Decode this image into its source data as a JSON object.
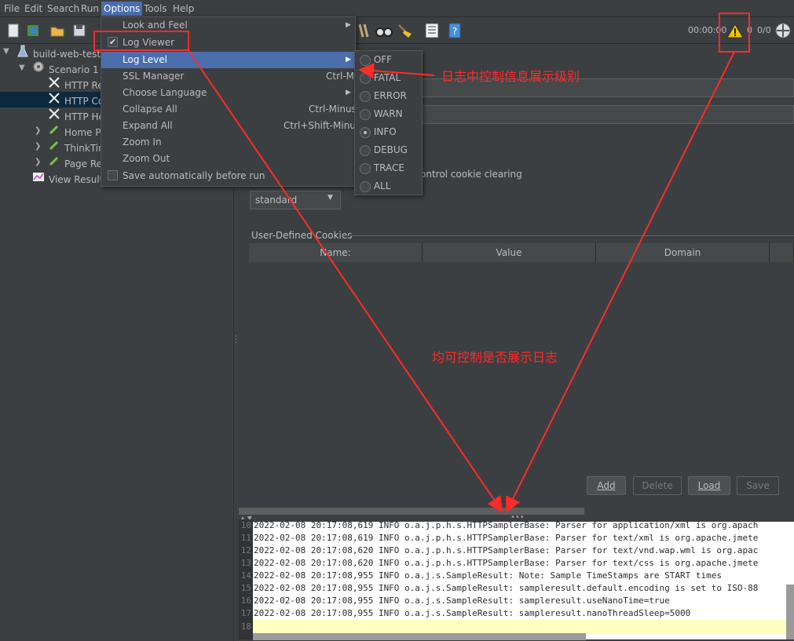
{
  "menubar": {
    "items": [
      "File",
      "Edit",
      "Search",
      "Run",
      "Options",
      "Tools",
      "Help"
    ]
  },
  "toolbar": {
    "timer": "00:00:00",
    "warning_count": "0",
    "thread_count": "0/0"
  },
  "tree": {
    "root": "build-web-test-p",
    "scenario": "Scenario 1",
    "items": [
      "HTTP Re",
      "HTTP Co",
      "HTTP He",
      "Home Pa",
      "ThinkTim",
      "Page Ret",
      "View Results"
    ]
  },
  "options_menu": {
    "items": [
      {
        "label": "Look and Feel",
        "shortcut": ""
      },
      {
        "label": "Log Viewer",
        "shortcut": ""
      },
      {
        "label": "Log Level",
        "shortcut": ""
      },
      {
        "label": "SSL Manager",
        "shortcut": "Ctrl-M"
      },
      {
        "label": "Choose Language",
        "shortcut": ""
      },
      {
        "label": "Collapse All",
        "shortcut": "Ctrl-Minus"
      },
      {
        "label": "Expand All",
        "shortcut": "Ctrl+Shift-Minus"
      },
      {
        "label": "Zoom In",
        "shortcut": ""
      },
      {
        "label": "Zoom Out",
        "shortcut": ""
      },
      {
        "label": "Save automatically before run",
        "shortcut": ""
      }
    ],
    "log_viewer_checked": true
  },
  "log_level_menu": {
    "options": [
      "OFF",
      "FATAL",
      "ERROR",
      "WARN",
      "INFO",
      "DEBUG",
      "TRACE",
      "ALL"
    ],
    "selected": "INFO"
  },
  "cookie_panel": {
    "clear_label": "ontrol cookie clearing",
    "policy": "standard",
    "section_title": "User-Defined Cookies",
    "columns": [
      "Name:",
      "Value",
      "Domain"
    ],
    "buttons": {
      "add": "Add",
      "delete": "Delete",
      "load": "Load",
      "save": "Save"
    }
  },
  "log": {
    "lines": [
      {
        "n": "10",
        "text": "2022-02-08 20:17:08,619 INFO o.a.j.p.h.s.HTTPSamplerBase: Parser for application/xml is org.apach"
      },
      {
        "n": "11",
        "text": "2022-02-08 20:17:08,619 INFO o.a.j.p.h.s.HTTPSamplerBase: Parser for text/xml is org.apache.jmete"
      },
      {
        "n": "12",
        "text": "2022-02-08 20:17:08,620 INFO o.a.j.p.h.s.HTTPSamplerBase: Parser for text/vnd.wap.wml is org.apac"
      },
      {
        "n": "13",
        "text": "2022-02-08 20:17:08,620 INFO o.a.j.p.h.s.HTTPSamplerBase: Parser for text/css is org.apache.jmete"
      },
      {
        "n": "14",
        "text": "2022-02-08 20:17:08,955 INFO o.a.j.s.SampleResult: Note: Sample TimeStamps are START times"
      },
      {
        "n": "15",
        "text": "2022-02-08 20:17:08,955 INFO o.a.j.s.SampleResult: sampleresult.default.encoding is set to ISO-88"
      },
      {
        "n": "16",
        "text": "2022-02-08 20:17:08,955 INFO o.a.j.s.SampleResult: sampleresult.useNanoTime=true"
      },
      {
        "n": "17",
        "text": "2022-02-08 20:17:08,955 INFO o.a.j.s.SampleResult: sampleresult.nanoThreadSleep=5000"
      },
      {
        "n": "18",
        "text": ""
      }
    ]
  },
  "annotations": {
    "log_level_note": "日志中控制信息展示级别",
    "toggle_note": "均可控制是否展示日志"
  },
  "colors": {
    "accent": "#4b6eaf",
    "annotation": "#ff2a2a",
    "log_bg": "#ffffff",
    "log_current_line": "#ffffc0"
  }
}
